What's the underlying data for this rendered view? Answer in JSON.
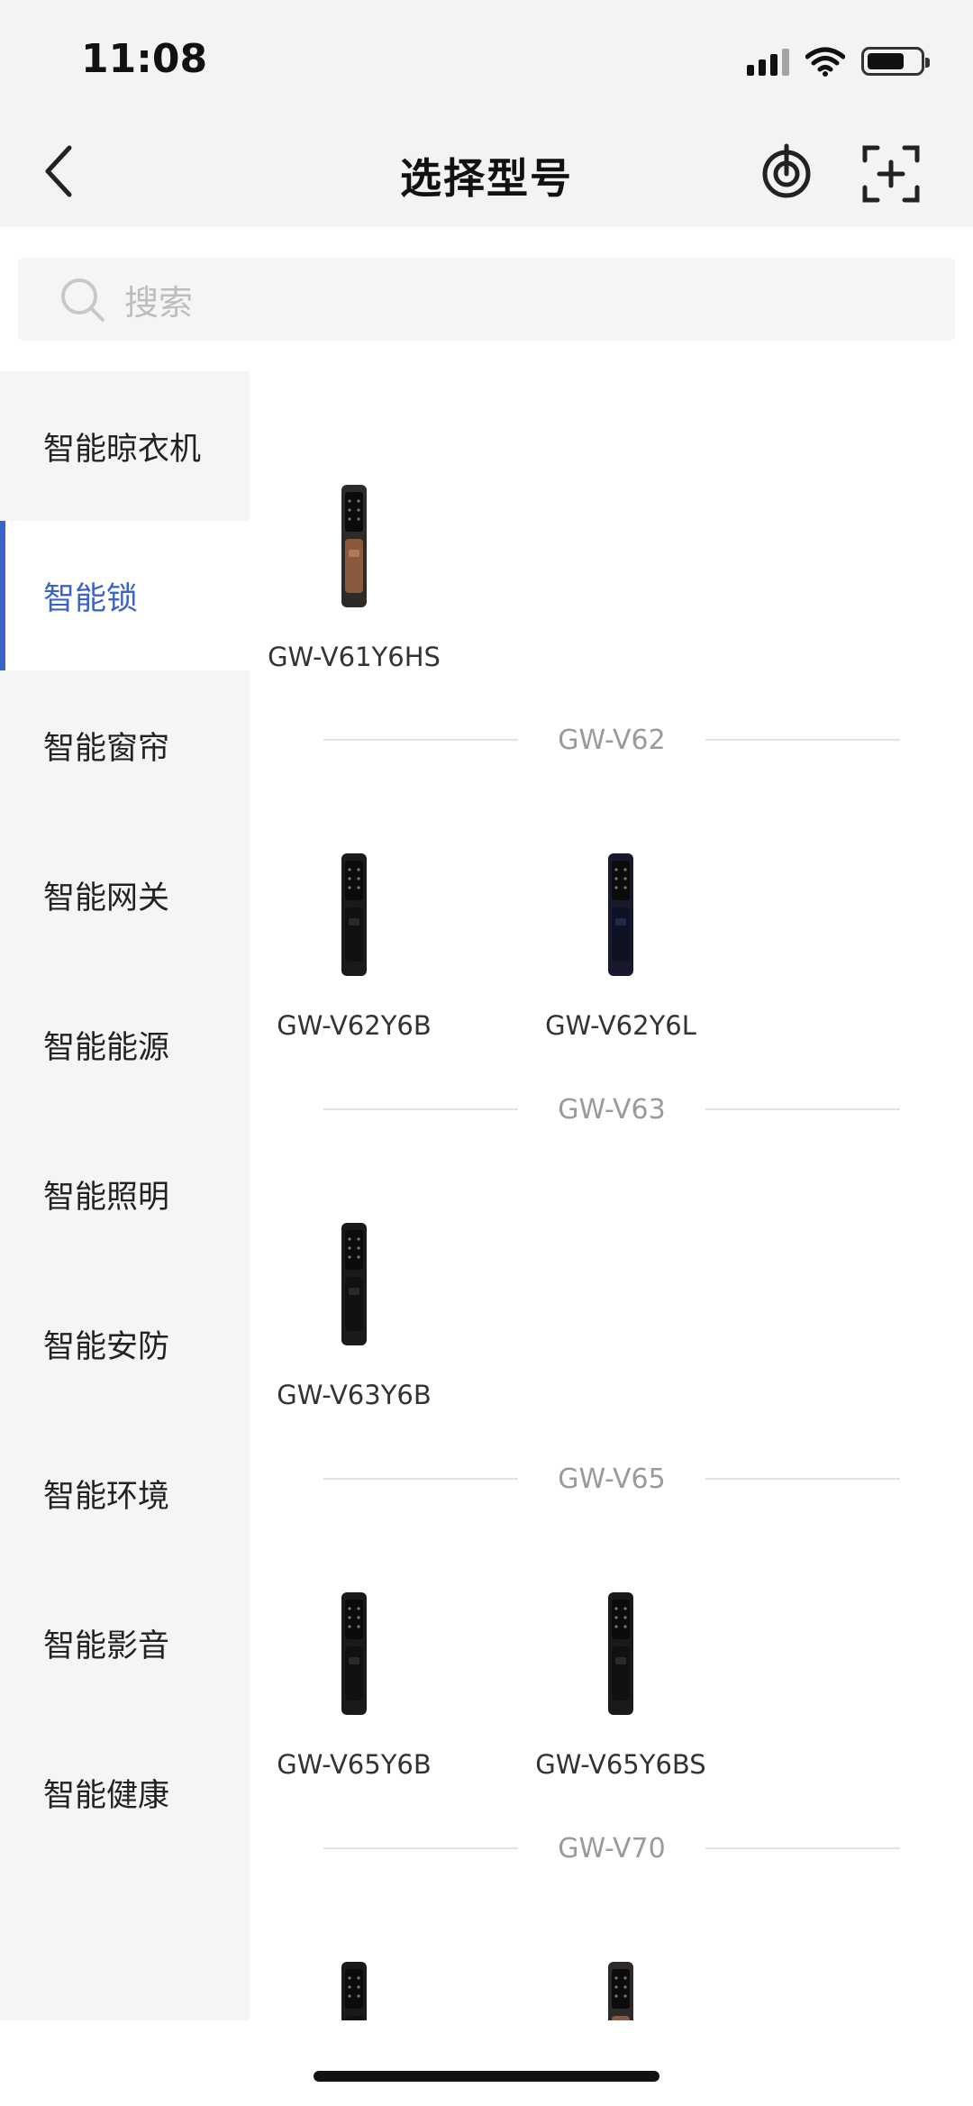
{
  "status_bar": {
    "time": "11:08"
  },
  "header": {
    "title": "选择型号"
  },
  "search": {
    "placeholder": "搜索"
  },
  "sidebar": {
    "items": [
      {
        "label": "智能晾衣机",
        "active": false
      },
      {
        "label": "智能锁",
        "active": true
      },
      {
        "label": "智能窗帘",
        "active": false
      },
      {
        "label": "智能网关",
        "active": false
      },
      {
        "label": "智能能源",
        "active": false
      },
      {
        "label": "智能照明",
        "active": false
      },
      {
        "label": "智能安防",
        "active": false
      },
      {
        "label": "智能环境",
        "active": false
      },
      {
        "label": "智能影音",
        "active": false
      },
      {
        "label": "智能健康",
        "active": false
      }
    ]
  },
  "groups": [
    {
      "title": "",
      "products": [
        {
          "name": "GW-V61Y6HS",
          "finish": "bronze"
        }
      ]
    },
    {
      "title": "GW-V62",
      "products": [
        {
          "name": "GW-V62Y6B",
          "finish": "black"
        },
        {
          "name": "GW-V62Y6L",
          "finish": "navy"
        }
      ]
    },
    {
      "title": "GW-V63",
      "products": [
        {
          "name": "GW-V63Y6B",
          "finish": "black"
        }
      ]
    },
    {
      "title": "GW-V65",
      "products": [
        {
          "name": "GW-V65Y6B",
          "finish": "black"
        },
        {
          "name": "GW-V65Y6BS",
          "finish": "black"
        }
      ]
    },
    {
      "title": "GW-V70",
      "products": [
        {
          "name": "",
          "finish": "black"
        },
        {
          "name": "",
          "finish": "bronze"
        }
      ]
    }
  ],
  "colors": {
    "accent": "#3a63c8",
    "sidebar_bg": "#f5f5f6",
    "header_bg": "#f3f3f5"
  }
}
